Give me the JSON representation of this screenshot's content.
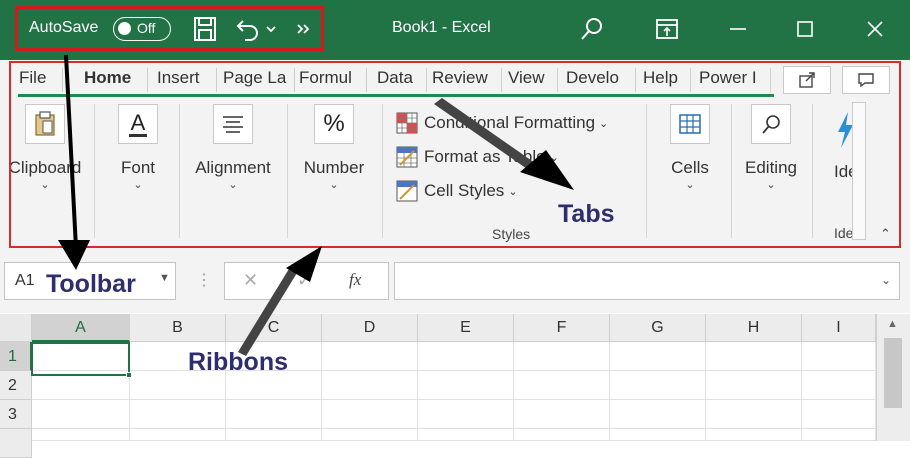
{
  "titlebar": {
    "autosave_label": "AutoSave",
    "autosave_state": "Off",
    "book_title": "Book1  -  Excel",
    "icons": [
      "save-icon",
      "undo-icon",
      "customize-qat-icon",
      "search-icon",
      "ribbon-display-icon",
      "minimize-icon",
      "maximize-icon",
      "close-icon"
    ]
  },
  "tabs": [
    {
      "label": "File",
      "active": false
    },
    {
      "label": "Home",
      "active": true
    },
    {
      "label": "Insert",
      "active": false
    },
    {
      "label": "Page La",
      "active": false
    },
    {
      "label": "Formul",
      "active": false
    },
    {
      "label": "Data",
      "active": false
    },
    {
      "label": "Review",
      "active": false
    },
    {
      "label": "View",
      "active": false
    },
    {
      "label": "Develo",
      "active": false
    },
    {
      "label": "Help",
      "active": false
    },
    {
      "label": "Power I",
      "active": false
    }
  ],
  "ribbon": {
    "clipboard": "Clipboard",
    "font": "Font",
    "alignment": "Alignment",
    "number": "Number",
    "number_glyph": "%",
    "font_glyph": "A",
    "conditional_formatting": "Conditional Formatting",
    "format_as_table": "Format as Table",
    "cell_styles": "Cell Styles",
    "styles_group": "Styles",
    "cells": "Cells",
    "editing": "Editing",
    "ideas_partial": "Ide",
    "ideas_group_partial": "Ide"
  },
  "formula_bar": {
    "name_box": "A1",
    "fx": "fx",
    "formula_value": ""
  },
  "grid": {
    "columns": [
      "A",
      "B",
      "C",
      "D",
      "E",
      "F",
      "G",
      "H",
      "I"
    ],
    "rows": [
      "1",
      "2",
      "3"
    ],
    "active_cell": "A1"
  },
  "annotations": {
    "toolbar": "Toolbar",
    "tabs": "Tabs",
    "ribbons": "Ribbons"
  },
  "colors": {
    "title_bar": "#217346",
    "highlight_border": "#d01c1c",
    "annotation_text": "#2e2e6e",
    "tab_underline": "#1e8c4e"
  }
}
